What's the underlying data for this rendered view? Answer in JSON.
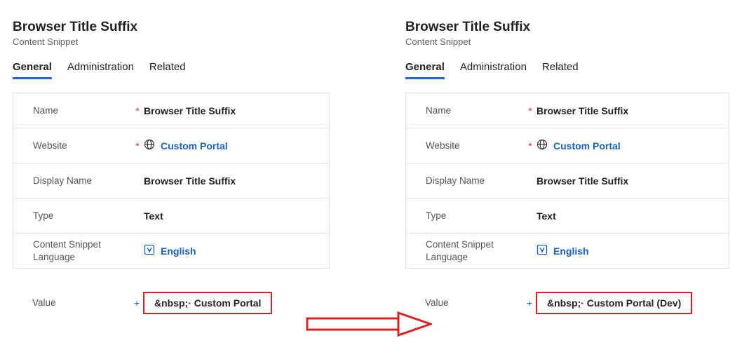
{
  "left": {
    "title": "Browser Title Suffix",
    "subtitle": "Content Snippet",
    "tabs": {
      "general": "General",
      "administration": "Administration",
      "related": "Related"
    },
    "fields": {
      "name_label": "Name",
      "name_value": "Browser Title Suffix",
      "website_label": "Website",
      "website_value": "Custom Portal",
      "displayname_label": "Display Name",
      "displayname_value": "Browser Title Suffix",
      "type_label": "Type",
      "type_value": "Text",
      "lang_label": "Content Snippet Language",
      "lang_value": "English"
    },
    "value_label": "Value",
    "value_value": "&nbsp;· Custom Portal"
  },
  "right": {
    "title": "Browser Title Suffix",
    "subtitle": "Content Snippet",
    "tabs": {
      "general": "General",
      "administration": "Administration",
      "related": "Related"
    },
    "fields": {
      "name_label": "Name",
      "name_value": "Browser Title Suffix",
      "website_label": "Website",
      "website_value": "Custom Portal",
      "displayname_label": "Display Name",
      "displayname_value": "Browser Title Suffix",
      "type_label": "Type",
      "type_value": "Text",
      "lang_label": "Content Snippet Language",
      "lang_value": "English"
    },
    "value_label": "Value",
    "value_value": "&nbsp;· Custom Portal (Dev)"
  },
  "req_star": "*",
  "req_plus": "+"
}
